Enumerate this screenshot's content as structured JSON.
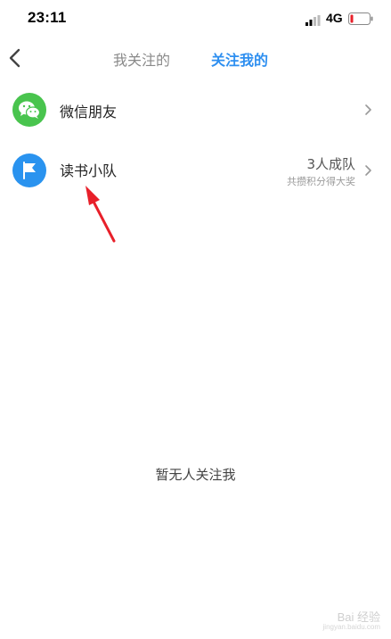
{
  "status_bar": {
    "time": "23:11",
    "network": "4G",
    "icons": [
      "signal-icon",
      "battery-icon"
    ]
  },
  "nav": {
    "back_icon": "chevron-left-icon",
    "tabs": [
      {
        "label": "我关注的",
        "active": false
      },
      {
        "label": "关注我的",
        "active": true
      }
    ],
    "active_color": "#2e8ff0",
    "inactive_color": "#8a8a8a"
  },
  "rows": [
    {
      "label": "微信朋友",
      "icon": "wechat-icon",
      "icon_color": "#49c44e",
      "trailing_icon": "chevron-right-icon"
    },
    {
      "label": "读书小队",
      "icon": "flag-icon",
      "icon_color": "#2a93ef",
      "count": "3人成队",
      "subtitle": "共攒积分得大奖",
      "trailing_icon": "chevron-right-icon"
    }
  ],
  "annotation": {
    "icon": "red-arrow-icon",
    "color": "#e8202a"
  },
  "empty_message": "暂无人关注我",
  "watermark": {
    "brand": "Bai 经验",
    "url": "jingyan.baidu.com"
  }
}
